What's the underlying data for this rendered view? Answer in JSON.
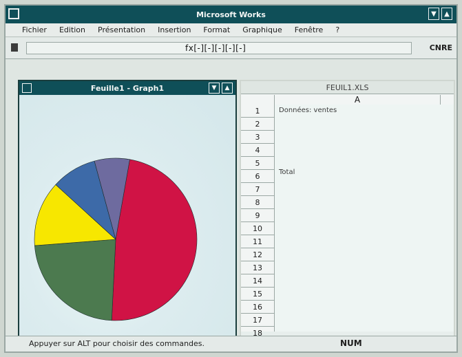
{
  "window": {
    "title": "Microsoft Works",
    "controls": {
      "minimize": "▼",
      "maximize": "▲"
    }
  },
  "menubar": {
    "items": [
      "Fichier",
      "Edition",
      "Présentation",
      "Insertion",
      "Format",
      "Graphique",
      "Fenêtre",
      "?"
    ]
  },
  "formula_bar": {
    "content": "fx[-][-][-][-][-]",
    "right_label": "CNRE"
  },
  "chart_window": {
    "title": "Feuille1 - Graph1",
    "controls": {
      "minimize": "▼",
      "maximize": "▲"
    }
  },
  "chart_data": {
    "type": "pie",
    "slices": [
      {
        "label": "",
        "value": 48,
        "color": "#d01345"
      },
      {
        "label": "",
        "value": 23,
        "color": "#4c7a4f"
      },
      {
        "label": "",
        "value": 13,
        "color": "#f7e700"
      },
      {
        "label": "",
        "value": 9,
        "color": "#3d6aa8"
      },
      {
        "label": "",
        "value": 7,
        "color": "#6e6b9f"
      }
    ]
  },
  "sheet_window": {
    "title": "FEUIL1.XLS",
    "column_header": "A",
    "rows": [
      "1",
      "2",
      "3",
      "4",
      "5",
      "6",
      "7",
      "8",
      "9",
      "10",
      "11",
      "12",
      "13",
      "14",
      "15",
      "16",
      "17",
      "18"
    ],
    "cell_A1": "Données: ventes",
    "cell_A6": "Total"
  },
  "status": {
    "text": "Appuyer sur ALT pour choisir des commandes.",
    "num": "NUM"
  }
}
